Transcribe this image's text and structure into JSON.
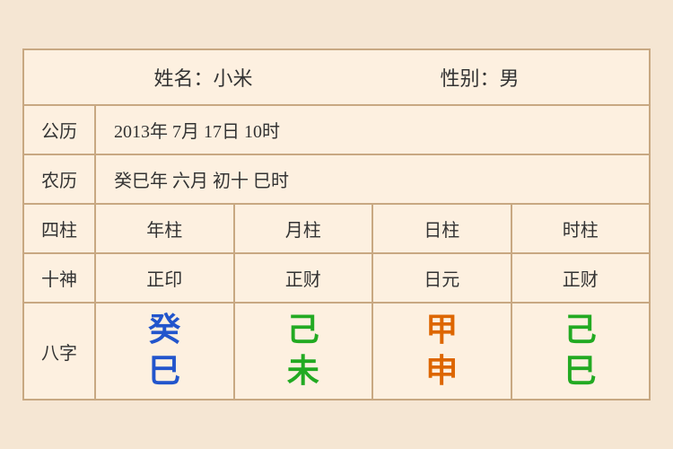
{
  "header": {
    "name_label": "姓名：小米",
    "gender_label": "性别：男"
  },
  "rows": {
    "gregorian_label": "公历",
    "gregorian_value": "2013年 7月 17日 10时",
    "lunar_label": "农历",
    "lunar_value": "癸巳年 六月 初十 巳时"
  },
  "sijhu_row": {
    "label": "四柱",
    "col1": "年柱",
    "col2": "月柱",
    "col3": "日柱",
    "col4": "时柱"
  },
  "shishen_row": {
    "label": "十神",
    "col1": "正印",
    "col2": "正财",
    "col3": "日元",
    "col4": "正财"
  },
  "bazhi_row": {
    "label": "八字",
    "col1_top": "癸",
    "col1_bottom": "巳",
    "col2_top": "己",
    "col2_bottom": "未",
    "col3_top": "甲",
    "col3_bottom": "申",
    "col4_top": "己",
    "col4_bottom": "巳"
  }
}
